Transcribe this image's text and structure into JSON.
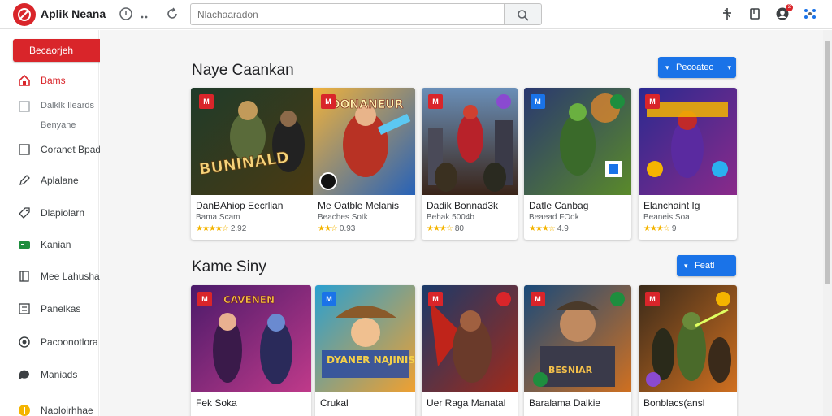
{
  "app": {
    "title": "Aplik Neana"
  },
  "search": {
    "placeholder": "Nlachaaradon"
  },
  "sidebar": {
    "primary_button": "Becaorjeh",
    "items": [
      {
        "label": "Bams",
        "icon": "home-icon",
        "active": true
      },
      {
        "label": "Dalklk Ileards",
        "icon": "checkbox-icon"
      },
      {
        "label": "Benyane",
        "icon": "none"
      },
      {
        "label": "Coranet Bpadid",
        "icon": "checkbox-icon"
      },
      {
        "label": "Aplalane",
        "icon": "pencil-icon"
      },
      {
        "label": "Dlapiolarn",
        "icon": "tag-icon"
      },
      {
        "label": "Kanian",
        "icon": "gamepad-icon"
      },
      {
        "label": "Mee Lahushaira",
        "icon": "book-icon"
      },
      {
        "label": "Panelkas",
        "icon": "list-icon"
      },
      {
        "label": "Pacoonotlora",
        "icon": "settings-icon"
      },
      {
        "label": "Maniads",
        "icon": "chat-icon"
      },
      {
        "label": "Naoloirhhae",
        "icon": "coin-icon"
      }
    ]
  },
  "sections": [
    {
      "title": "Naye Caankan",
      "button": "Pecoateo",
      "cards": [
        {
          "name": "DanBAhiop Eecrlian",
          "sub": "Bama Scam",
          "rating": "2.92"
        },
        {
          "name": "Me Oatble Melanis",
          "sub": "Beaches Sotk",
          "rating": "0.93"
        },
        {
          "name": "Dadik Bonnad3k",
          "sub": "Behak 5004b",
          "rating": "80"
        },
        {
          "name": "Datle Canbag",
          "sub": "Beaead FOdk",
          "rating": "4.9"
        },
        {
          "name": "Elanchaint Ig",
          "sub": "Beaneis Soa",
          "rating": "9"
        }
      ]
    },
    {
      "title": "Kame Siny",
      "button": "Featl",
      "cards": [
        {
          "name": "Fek Soka",
          "sub": "",
          "rating": ""
        },
        {
          "name": "Crukal",
          "sub": "",
          "rating": ""
        },
        {
          "name": "Uer Raga Manatal",
          "sub": "",
          "rating": ""
        },
        {
          "name": "Baralama Dalkie",
          "sub": "",
          "rating": ""
        },
        {
          "name": "Bonblacs(ansl",
          "sub": "",
          "rating": ""
        }
      ]
    }
  ],
  "cover_text": {
    "c0": "BUNINALD",
    "c1": "DOONANEUR",
    "r1_c0": "CAVENEN",
    "r1_c1": "DYANER NAJINIS",
    "r1_c3": "BESNIAR"
  },
  "colors": {
    "accent": "#d9252a",
    "primary_blue": "#1a73e8",
    "star": "#f4b400"
  }
}
